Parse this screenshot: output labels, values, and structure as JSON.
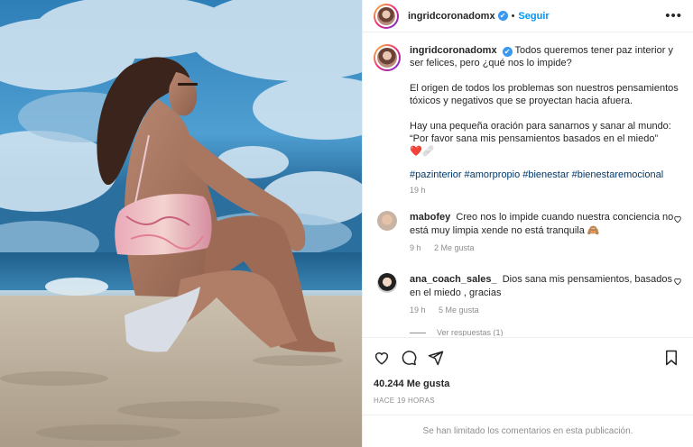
{
  "post": {
    "username": "ingridcoronadomx",
    "verified_glyph": "✔",
    "separator": "•",
    "follow_label": "Seguir",
    "more_glyph": "•••"
  },
  "caption": {
    "username": "ingridcoronadomx",
    "p1": "Todos queremos tener paz interior y ser felices, pero ¿qué nos lo impide?",
    "p2": "El origen de todos los problemas son nuestros pensamientos tóxicos y negativos que se proyectan hacia afuera.",
    "p3a": "Hay una pequeña oración para sanarnos y sanar al mundo:",
    "p3b": "“Por favor sana mis pensamientos basados en el miedo”",
    "emojis": "❤️🩹",
    "hashtags": [
      "#pazinterior",
      "#amorpropio",
      "#bienestar",
      "#bienestaremocional"
    ],
    "time": "19 h"
  },
  "comments": [
    {
      "username": "mabofey",
      "text": "Creo nos lo impide cuando nuestra conciencia no está muy limpia xende no está tranquila 🙈",
      "time": "9 h",
      "likes": "2 Me gusta",
      "heart_icon": "heart-outline-icon"
    },
    {
      "username": "ana_coach_sales_",
      "text": "Dios sana mis pensamientos, basados en el miedo , gracias",
      "time": "19 h",
      "likes": "5 Me gusta",
      "heart_icon": "heart-outline-icon"
    }
  ],
  "replies_label": "Ver respuestas (1)",
  "stats": {
    "likes": "40.244 Me gusta",
    "ago": "HACE 19 HORAS"
  },
  "limited_comments": "Se han limitado los comentarios en esta publicación.",
  "colors": {
    "accent": "#0095f6",
    "verified": "#3897f0",
    "muted": "#8e8e8e"
  }
}
